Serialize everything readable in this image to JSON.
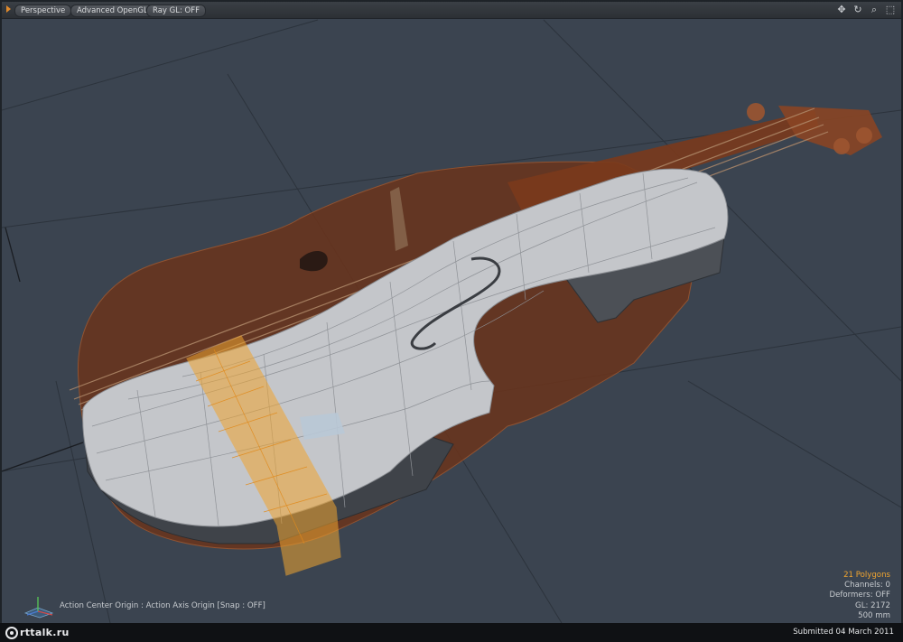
{
  "viewport": {
    "menu_arrow_icon": "triangle-right",
    "buttons": [
      {
        "label": "Perspective"
      },
      {
        "label": "Advanced OpenGL"
      },
      {
        "label": "Ray GL: OFF"
      }
    ],
    "nav_icons": [
      "move-icon",
      "rotate-icon",
      "zoom-icon",
      "maximize-icon"
    ]
  },
  "stats": {
    "polygons": "21 Polygons",
    "channels": "Channels: 0",
    "deformers": "Deformers: OFF",
    "gl": "GL: 2172",
    "scale": "500 mm"
  },
  "status": {
    "action_center": "Action Center Origin : Action Axis Origin  [Snap : OFF]"
  },
  "footer": {
    "logo_text": "rttalk.ru",
    "submitted": "Submitted 04 March 2011"
  },
  "colors": {
    "viewport_bg": "#3b4450",
    "selection": "#f0a530",
    "mesh": "#c9cbcf",
    "wood": "#7a3a1c"
  }
}
